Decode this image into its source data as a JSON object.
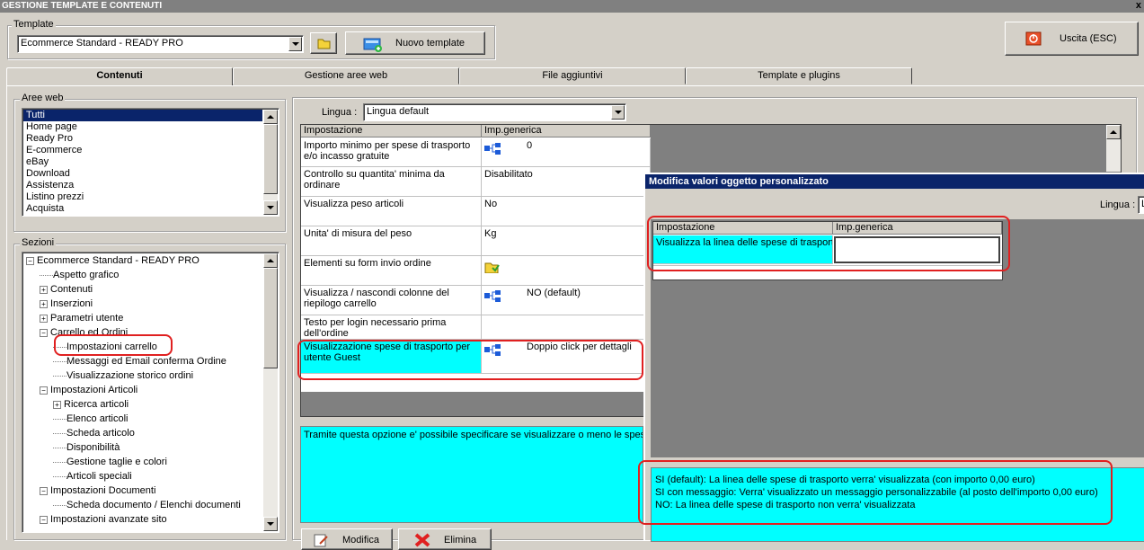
{
  "window": {
    "title": "GESTIONE TEMPLATE E CONTENUTI"
  },
  "template": {
    "label": "Template",
    "selected": "Ecommerce Standard - READY PRO",
    "new_button": "Nuovo template"
  },
  "exit_button": "Uscita (ESC)",
  "tabs": [
    "Contenuti",
    "Gestione aree web",
    "File aggiuntivi",
    "Template e plugins"
  ],
  "aree_web": {
    "label": "Aree web",
    "items": [
      "Tutti",
      "Home page",
      "Ready Pro",
      "E-commerce",
      "eBay",
      "Download",
      "Assistenza",
      "Listino prezzi",
      "Acquista"
    ]
  },
  "sezioni": {
    "label": "Sezioni",
    "items": [
      {
        "text": "Ecommerce Standard - READY PRO",
        "toggle": "−"
      },
      {
        "text": "Aspetto grafico",
        "toggle": ""
      },
      {
        "text": "Contenuti",
        "toggle": "+"
      },
      {
        "text": "Inserzioni",
        "toggle": "+"
      },
      {
        "text": "Parametri utente",
        "toggle": "+"
      },
      {
        "text": "Carrello ed Ordini",
        "toggle": "−"
      },
      {
        "text": "Impostazioni carrello",
        "toggle": ""
      },
      {
        "text": "Messaggi ed Email conferma Ordine",
        "toggle": ""
      },
      {
        "text": "Visualizzazione storico ordini",
        "toggle": ""
      },
      {
        "text": "Impostazioni Articoli",
        "toggle": "−"
      },
      {
        "text": "Ricerca articoli",
        "toggle": "+"
      },
      {
        "text": "Elenco articoli",
        "toggle": ""
      },
      {
        "text": "Scheda articolo",
        "toggle": ""
      },
      {
        "text": "Disponibilità",
        "toggle": ""
      },
      {
        "text": "Gestione taglie e colori",
        "toggle": ""
      },
      {
        "text": "Articoli speciali",
        "toggle": ""
      },
      {
        "text": "Impostazioni Documenti",
        "toggle": "−"
      },
      {
        "text": "Scheda documento / Elenchi documenti",
        "toggle": ""
      },
      {
        "text": "Impostazioni avanzate sito",
        "toggle": "−"
      }
    ]
  },
  "lingua": {
    "label": "Lingua :",
    "selected": "Lingua default"
  },
  "settings_grid": {
    "headers": [
      "Impostazione",
      "Imp.generica"
    ],
    "rows": [
      {
        "name": "Importo minimo per spese di trasporto e/o incasso gratuite",
        "value": "0",
        "icon": "tree-icon"
      },
      {
        "name": "Controllo su quantita' minima da ordinare",
        "value": "Disabilitato",
        "icon": ""
      },
      {
        "name": "Visualizza peso articoli",
        "value": "No",
        "icon": ""
      },
      {
        "name": "Unita' di misura del peso",
        "value": "Kg",
        "icon": ""
      },
      {
        "name": "Elementi su form invio ordine",
        "value": "",
        "icon": "folder-icon"
      },
      {
        "name": "Visualizza / nascondi colonne del riepilogo carrello",
        "value": "NO (default)",
        "icon": "tree-icon"
      },
      {
        "name": "Testo per login necessario prima dell'ordine",
        "value": "",
        "icon": ""
      },
      {
        "name": "Visualizzazione spese di trasporto per utente Guest",
        "value": "Doppio click per dettagli",
        "icon": "tree-icon"
      }
    ]
  },
  "description": "Tramite questa opzione e' possibile specificare se visualizzare o meno le spese",
  "bottom_buttons": [
    "Modifica",
    "Elimina"
  ],
  "dialog": {
    "title": "Modifica valori oggetto personalizzato",
    "lingua_label": "Lingua :",
    "lingua_value": "L",
    "headers": [
      "Impostazione",
      "Imp.generica"
    ],
    "row_name": "Visualizza la linea delle spese di trasporto",
    "row_value": "",
    "help_lines": [
      "SI (default): La linea delle spese di trasporto verra' visualizzata (con importo 0,00 euro)",
      "SI con messaggio: Verra' visualizzato un messaggio personalizzabile (al posto dell'importo 0,00 euro)",
      "NO: La linea delle spese di trasporto non verra' visualizzata"
    ]
  },
  "colors": {
    "highlight": "#00ffff",
    "selection": "#0a246a",
    "annotation": "#e02020"
  }
}
